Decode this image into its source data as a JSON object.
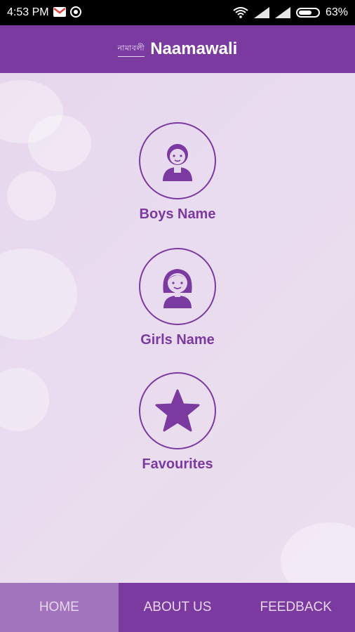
{
  "status_bar": {
    "time": "4:53 PM",
    "battery": "63%",
    "icons": [
      "gmail-icon",
      "whatsapp-icon",
      "wifi-icon",
      "signal-icon",
      "signal-icon",
      "battery-icon"
    ]
  },
  "app_bar": {
    "logo_text": "নামাবলী",
    "title": "Naamawali"
  },
  "menu": {
    "boys": {
      "label": "Boys Name",
      "icon": "boy-icon"
    },
    "girls": {
      "label": "Girls Name",
      "icon": "girl-icon"
    },
    "favourites": {
      "label": "Favourites",
      "icon": "star-icon"
    }
  },
  "bottom_nav": {
    "tabs": [
      {
        "label": "HOME",
        "active": true
      },
      {
        "label": "ABOUT US",
        "active": false
      },
      {
        "label": "FEEDBACK",
        "active": false
      }
    ]
  },
  "colors": {
    "primary": "#7b3aa0",
    "active_tab": "#a274bd",
    "background": "#e8dced"
  }
}
